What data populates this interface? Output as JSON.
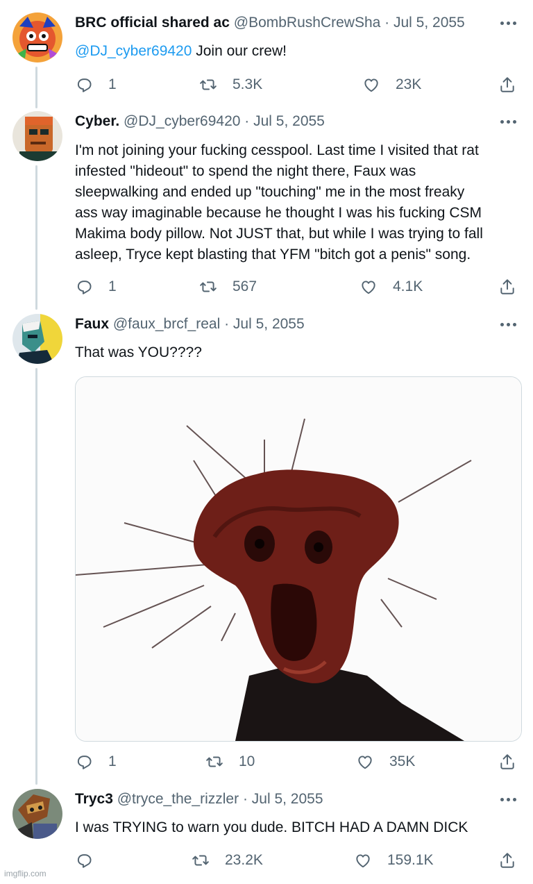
{
  "tweets": [
    {
      "name": "BRC official shared ac",
      "meta": "@BombRushCrewSha · Jul 5, 2055",
      "mention": "@DJ_cyber69420",
      "text": " Join our crew!",
      "replies": "1",
      "retweets": "5.3K",
      "likes": "23K"
    },
    {
      "name": "Cyber.",
      "meta": "@DJ_cyber69420 · Jul 5, 2055",
      "lines": [
        "I'm not joining your fucking cesspool. Last time I visited that rat",
        "infested \"hideout\" to spend the night there, Faux was",
        "sleepwalking and ended up \"touching\" me in the most freaky",
        "ass way imaginable because he thought I was his fucking CSM",
        "Makima body pillow. Not JUST that, but while I was trying to fall",
        "asleep, Tryce kept blasting that YFM \"bitch got a penis\" song."
      ],
      "replies": "1",
      "retweets": "567",
      "likes": "4.1K"
    },
    {
      "name": "Faux",
      "meta": "@faux_brcf_real · Jul 5, 2055",
      "text": "That was YOU????",
      "replies": "1",
      "retweets": "10",
      "likes": "35K"
    },
    {
      "name": "Tryc3",
      "meta": "@tryce_the_rizzler · Jul 5, 2055",
      "text": "I was TRYING to warn you dude. BITCH HAD A DAMN DICK",
      "replies": "",
      "retweets": "23.2K",
      "likes": "159.1K"
    }
  ],
  "watermark": "imgflip.com",
  "icons": {
    "reply": "reply-icon",
    "retweet": "retweet-icon",
    "like": "heart-icon",
    "share": "share-icon",
    "more": "more-icon"
  },
  "colors": {
    "mention": "#1d9bf0",
    "meta": "#536471",
    "thread_line": "#cfd9de"
  }
}
